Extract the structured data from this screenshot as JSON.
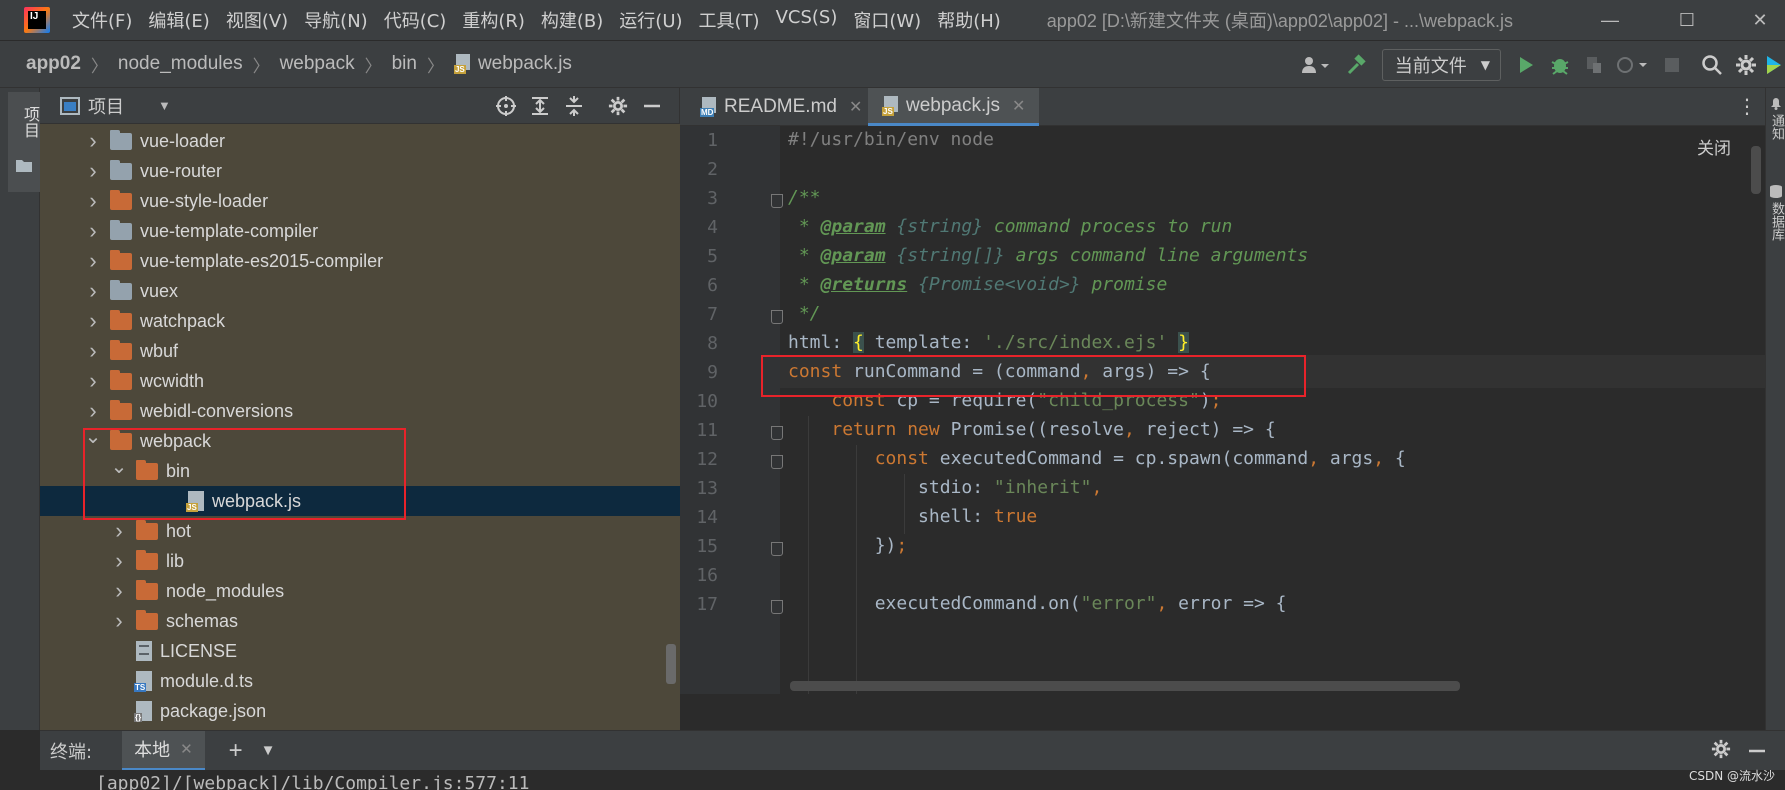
{
  "app": {
    "logo_text": "IJ",
    "menu": [
      "文件(F)",
      "编辑(E)",
      "视图(V)",
      "导航(N)",
      "代码(C)",
      "重构(R)",
      "构建(B)",
      "运行(U)",
      "工具(T)",
      "VCS(S)",
      "窗口(W)",
      "帮助(H)"
    ],
    "window_title": "app02 [D:\\新建文件夹 (桌面)\\app02\\app02] - ...\\webpack.js"
  },
  "breadcrumb": [
    "app02",
    "node_modules",
    "webpack",
    "bin",
    "webpack.js"
  ],
  "toolbar": {
    "run_config": "当前文件"
  },
  "project_panel": {
    "title": "项目",
    "strip_label": "项目"
  },
  "tree": [
    {
      "label": "vue-loader",
      "type": "folder-grey",
      "arrow": "right"
    },
    {
      "label": "vue-router",
      "type": "folder-grey",
      "arrow": "right"
    },
    {
      "label": "vue-style-loader",
      "type": "folder-orange",
      "arrow": "right"
    },
    {
      "label": "vue-template-compiler",
      "type": "folder-grey",
      "arrow": "right"
    },
    {
      "label": "vue-template-es2015-compiler",
      "type": "folder-orange",
      "arrow": "right"
    },
    {
      "label": "vuex",
      "type": "folder-grey",
      "arrow": "right"
    },
    {
      "label": "watchpack",
      "type": "folder-orange",
      "arrow": "right"
    },
    {
      "label": "wbuf",
      "type": "folder-orange",
      "arrow": "right"
    },
    {
      "label": "wcwidth",
      "type": "folder-orange",
      "arrow": "right"
    },
    {
      "label": "webidl-conversions",
      "type": "folder-orange",
      "arrow": "right"
    },
    {
      "label": "webpack",
      "type": "folder-orange",
      "arrow": "down"
    },
    {
      "label": "bin",
      "type": "folder-orange",
      "arrow": "down"
    },
    {
      "label": "webpack.js",
      "type": "file-js",
      "arrow": "",
      "selected": true
    },
    {
      "label": "hot",
      "type": "folder-orange",
      "arrow": "right"
    },
    {
      "label": "lib",
      "type": "folder-orange",
      "arrow": "right"
    },
    {
      "label": "node_modules",
      "type": "folder-orange",
      "arrow": "right"
    },
    {
      "label": "schemas",
      "type": "folder-orange",
      "arrow": "right"
    },
    {
      "label": "LICENSE",
      "type": "file-text",
      "arrow": ""
    },
    {
      "label": "module.d.ts",
      "type": "file-ts",
      "arrow": ""
    },
    {
      "label": "package.json",
      "type": "file-json",
      "arrow": ""
    }
  ],
  "editor": {
    "tabs": [
      {
        "label": "README.md",
        "icon": "MD",
        "active": false
      },
      {
        "label": "webpack.js",
        "icon": "JS",
        "active": true
      }
    ],
    "close_hint": "关闭",
    "lines": [
      {
        "n": "1",
        "fold": false,
        "tokens": [
          [
            "sh",
            "#!/usr/bin/env node"
          ]
        ]
      },
      {
        "n": "2",
        "fold": false,
        "tokens": []
      },
      {
        "n": "3",
        "fold": true,
        "tokens": [
          [
            "com",
            "/**"
          ]
        ]
      },
      {
        "n": "4",
        "fold": false,
        "tokens": [
          [
            "com",
            " * "
          ],
          [
            "tag",
            "@param"
          ],
          [
            "com",
            " "
          ],
          [
            "type",
            "{string}"
          ],
          [
            "com",
            " command process to run"
          ]
        ]
      },
      {
        "n": "5",
        "fold": false,
        "tokens": [
          [
            "com",
            " * "
          ],
          [
            "tag",
            "@param"
          ],
          [
            "com",
            " "
          ],
          [
            "type",
            "{string[]}"
          ],
          [
            "com",
            " args command line arguments"
          ]
        ]
      },
      {
        "n": "6",
        "fold": false,
        "tokens": [
          [
            "com",
            " * "
          ],
          [
            "tag",
            "@returns"
          ],
          [
            "com",
            " "
          ],
          [
            "type",
            "{Promise<void>}"
          ],
          [
            "com",
            " promise"
          ]
        ]
      },
      {
        "n": "7",
        "fold": true,
        "tokens": [
          [
            "com",
            " */"
          ]
        ]
      },
      {
        "n": "8",
        "fold": false,
        "tokens": [
          [
            "p",
            "html: "
          ],
          [
            "br",
            "{"
          ],
          [
            "p",
            " template: "
          ],
          [
            "str",
            "'./src/index.ejs'"
          ],
          [
            "p",
            " "
          ],
          [
            "br",
            "}"
          ]
        ]
      },
      {
        "n": "9",
        "fold": false,
        "tokens": [
          [
            "kw",
            "const"
          ],
          [
            "p",
            " runCommand = (command"
          ],
          [
            "kw",
            ","
          ],
          [
            "p",
            " args) => {"
          ]
        ]
      },
      {
        "n": "10",
        "fold": false,
        "tokens": [
          [
            "p",
            "    "
          ],
          [
            "kw",
            "const"
          ],
          [
            "p",
            " cp = require("
          ],
          [
            "str",
            "\"child_process\""
          ],
          [
            "p",
            ")"
          ],
          [
            "kw",
            ";"
          ]
        ]
      },
      {
        "n": "11",
        "fold": true,
        "tokens": [
          [
            "p",
            "    "
          ],
          [
            "kw",
            "return new"
          ],
          [
            "p",
            " Promise((resolve"
          ],
          [
            "kw",
            ","
          ],
          [
            "p",
            " reject) => {"
          ]
        ]
      },
      {
        "n": "12",
        "fold": true,
        "tokens": [
          [
            "p",
            "        "
          ],
          [
            "kw",
            "const"
          ],
          [
            "p",
            " executedCommand = cp.spawn(command"
          ],
          [
            "kw",
            ","
          ],
          [
            "p",
            " args"
          ],
          [
            "kw",
            ","
          ],
          [
            "p",
            " {"
          ]
        ]
      },
      {
        "n": "13",
        "fold": false,
        "tokens": [
          [
            "p",
            "            stdio: "
          ],
          [
            "str",
            "\"inherit\""
          ],
          [
            "kw",
            ","
          ]
        ]
      },
      {
        "n": "14",
        "fold": false,
        "tokens": [
          [
            "p",
            "            shell: "
          ],
          [
            "kw",
            "true"
          ]
        ]
      },
      {
        "n": "15",
        "fold": true,
        "tokens": [
          [
            "p",
            "        })"
          ],
          [
            "kw",
            ";"
          ]
        ]
      },
      {
        "n": "16",
        "fold": false,
        "tokens": []
      },
      {
        "n": "17",
        "fold": true,
        "tokens": [
          [
            "p",
            "        executedCommand.on("
          ],
          [
            "str",
            "\"error\""
          ],
          [
            "kw",
            ","
          ],
          [
            "p",
            " error => {"
          ]
        ]
      }
    ]
  },
  "right_strip": {
    "notifications": "通知",
    "database": "数据库"
  },
  "terminal": {
    "label": "终端:",
    "tab": "本地",
    "line": "[app02]/[webpack]/lib/Compiler.js:577:11"
  },
  "watermark": "CSDN @流水沙",
  "colors": {
    "accent": "#4a88c7",
    "highlight_box": "#e8232a"
  }
}
